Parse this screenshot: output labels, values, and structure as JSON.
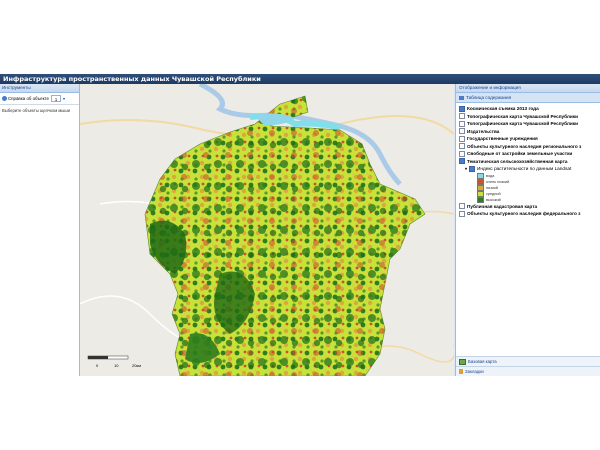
{
  "app": {
    "title": "Инфраструктура пространственных данных Чувашской Республики"
  },
  "left_panel": {
    "header": "Инструменты",
    "tool_label": "Справка об объекте",
    "select_value": "1",
    "hint": "Выберите объекты щелчком мыши"
  },
  "right_panel": {
    "header": "Отображение и информация",
    "tab": "Таблица содержания",
    "layers": [
      {
        "label": "Космическая съемка 2013 года",
        "checked": true
      },
      {
        "label": "Топографическая карта Чувашской Республики",
        "checked": false
      },
      {
        "label": "Топографическая карта Чувашской Республики",
        "checked": false
      },
      {
        "label": "Издательства",
        "checked": false
      },
      {
        "label": "Государственные учреждения",
        "checked": false
      },
      {
        "label": "Объекты культурного наследия регионального з",
        "checked": false
      },
      {
        "label": "Свободные от застройки земельные участки",
        "checked": false
      },
      {
        "label": "Тематическая сельскохозяйственная карта",
        "checked": true
      }
    ],
    "sublayer": "Индекс растительности по данным Landsat",
    "legend": [
      {
        "label": "вода",
        "color": "#8fd6e8"
      },
      {
        "label": "очень низкий",
        "color": "#c9532a"
      },
      {
        "label": "низкий",
        "color": "#d9a93a"
      },
      {
        "label": "средний",
        "color": "#c8e23a"
      },
      {
        "label": "высокий",
        "color": "#2e7d1e"
      }
    ],
    "layers_after": [
      {
        "label": "Публичная кадастровая карта",
        "checked": false
      },
      {
        "label": "Объекты культурного наследия федерального з",
        "checked": false
      }
    ],
    "footer": [
      {
        "label": "Базовая карта",
        "icon": "map-icon"
      },
      {
        "label": "Закладки",
        "icon": "bookmark-icon"
      }
    ]
  },
  "map": {
    "scale_labels": [
      "0",
      "10",
      "20км"
    ]
  },
  "colors": {
    "water": "#8fd6e8",
    "very_low": "#c9532a",
    "low": "#d9a93a",
    "medium": "#c8e23a",
    "high": "#2e7d1e",
    "panel_header": "#c7d8ed",
    "title_bar": "#1e3a63"
  }
}
